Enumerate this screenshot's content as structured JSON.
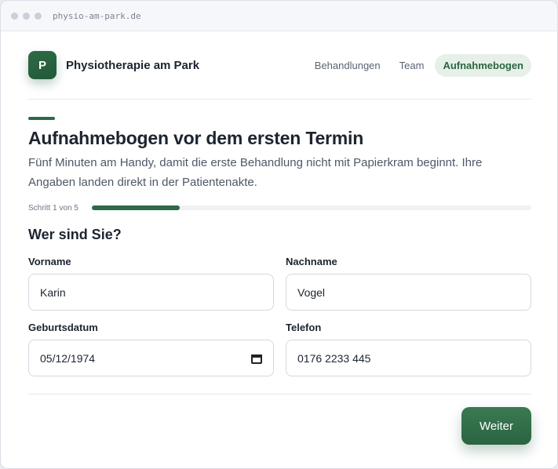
{
  "browser": {
    "url": "physio-am-park.de"
  },
  "header": {
    "logo_letter": "P",
    "brand": "Physiotherapie am Park",
    "nav": [
      {
        "label": "Behandlungen",
        "active": false
      },
      {
        "label": "Team",
        "active": false
      },
      {
        "label": "Aufnahmebogen",
        "active": true
      }
    ]
  },
  "intro": {
    "title": "Aufnahmebogen vor dem ersten Termin",
    "subtitle": "Fünf Minuten am Handy, damit die erste Behandlung nicht mit Papierkram beginnt. Ihre Angaben landen direkt in der Patientenakte."
  },
  "progress": {
    "label": "Schritt 1 von 5",
    "fraction": 0.2
  },
  "form": {
    "section_title": "Wer sind Sie?",
    "fields": {
      "first_name": {
        "label": "Vorname",
        "value": "Karin"
      },
      "last_name": {
        "label": "Nachname",
        "value": "Vogel"
      },
      "birthdate": {
        "label": "Geburtsdatum",
        "value": "05/12/1974"
      },
      "phone": {
        "label": "Telefon",
        "value": "0176 2233 445"
      }
    },
    "next_label": "Weiter"
  },
  "colors": {
    "accent": "#2e6a45",
    "accent_soft": "#e6f0e9"
  }
}
